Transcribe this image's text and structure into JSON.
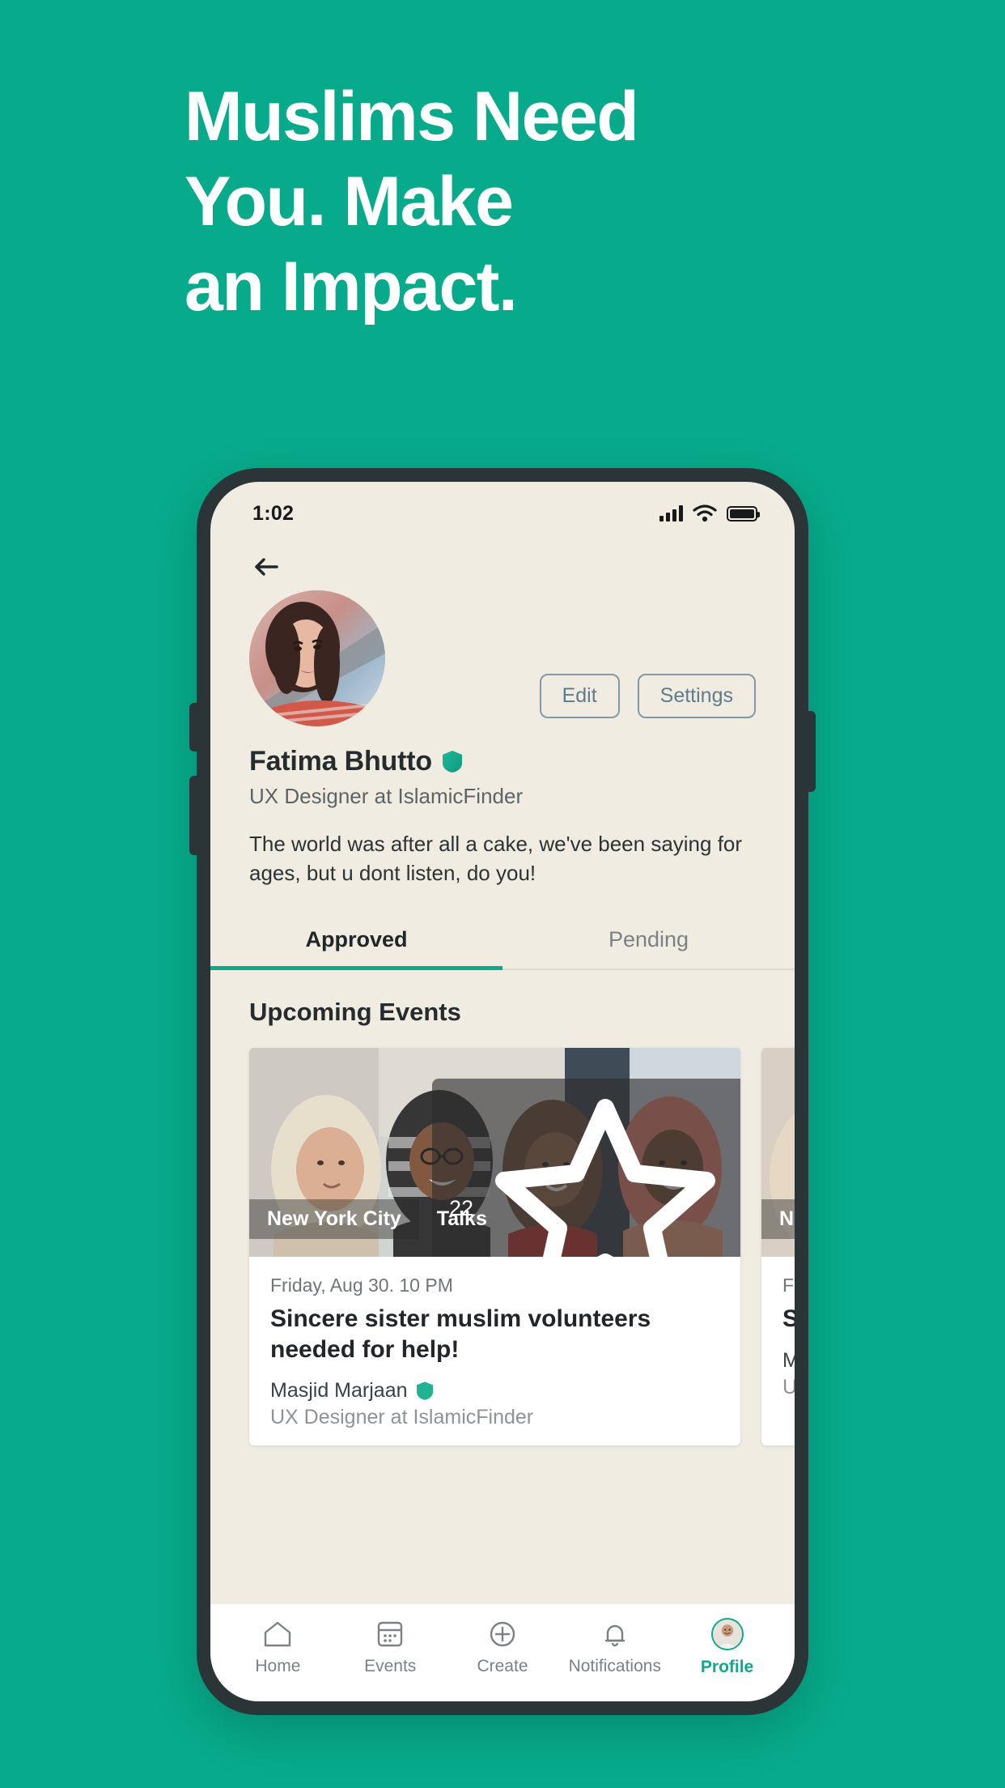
{
  "promo": {
    "background_color": "#07ab8b",
    "headline_lines": [
      "Muslims Need",
      "You. Make",
      "an Impact."
    ]
  },
  "phone": {
    "statusbar": {
      "time": "1:02",
      "icons": [
        "signal-icon",
        "wifi-icon",
        "battery-icon"
      ]
    }
  },
  "app": {
    "back_icon": "back-arrow-icon",
    "profile": {
      "avatar": "profile-avatar",
      "name": "Fatima Bhutto",
      "verified_badge": "verified-shield-icon",
      "subtitle": "UX Designer at IslamicFinder",
      "bio": "The world was after all a cake, we've been saying for ages, but u dont listen, do you!",
      "actions": [
        {
          "label": "Edit",
          "name": "edit-button"
        },
        {
          "label": "Settings",
          "name": "settings-button"
        }
      ]
    },
    "tabs": [
      {
        "label": "Approved",
        "active": true
      },
      {
        "label": "Pending",
        "active": false
      }
    ],
    "events_section": {
      "title": "Upcoming Events",
      "cards": [
        {
          "favorite_count": "22",
          "favorite_icon": "star-icon",
          "chips": [
            "New York City",
            "Talks"
          ],
          "date": "Friday, Aug 30. 10 PM",
          "title": "Sincere sister muslim volunteers needed for help!",
          "organizer": "Masjid Marjaan",
          "organizer_badge": "verified-shield-icon",
          "organizer_subtitle": "UX Designer at IslamicFinder"
        },
        {
          "favorite_count": "",
          "favorite_icon": "star-icon",
          "chips": [
            "N"
          ],
          "date": "F",
          "title": "S m",
          "organizer": "M",
          "organizer_badge": "verified-shield-icon",
          "organizer_subtitle": "U"
        }
      ]
    },
    "bottom_nav": [
      {
        "label": "Home",
        "icon": "home-icon",
        "active": false
      },
      {
        "label": "Events",
        "icon": "calendar-icon",
        "active": false
      },
      {
        "label": "Create",
        "icon": "plus-circle-icon",
        "active": false
      },
      {
        "label": "Notifications",
        "icon": "bell-icon",
        "active": false
      },
      {
        "label": "Profile",
        "icon": "profile-avatar-icon",
        "active": true
      }
    ]
  },
  "colors": {
    "brand_green": "#0aab8c",
    "screen_bg": "#f0ece1",
    "card_bg": "#ffffff",
    "button_outline": "#7f9aa8"
  }
}
